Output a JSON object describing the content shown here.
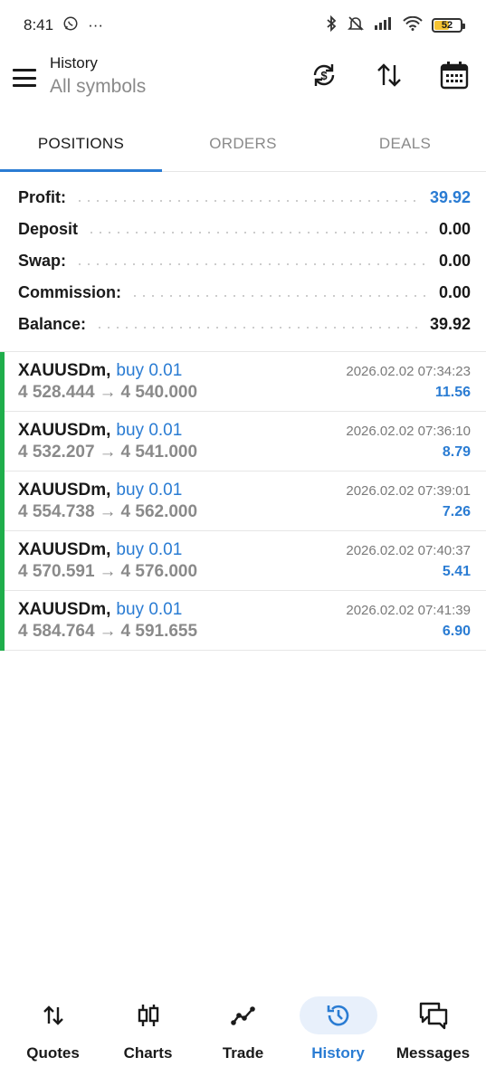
{
  "status_bar": {
    "time": "8:41",
    "more": "···",
    "battery": "52"
  },
  "header": {
    "title": "History",
    "subtitle": "All symbols"
  },
  "tabs": [
    {
      "label": "POSITIONS",
      "active": true
    },
    {
      "label": "ORDERS",
      "active": false
    },
    {
      "label": "DEALS",
      "active": false
    }
  ],
  "summary": [
    {
      "label": "Profit:",
      "value": "39.92",
      "highlight": true
    },
    {
      "label": "Deposit",
      "value": "0.00",
      "highlight": false
    },
    {
      "label": "Swap:",
      "value": "0.00",
      "highlight": false
    },
    {
      "label": "Commission:",
      "value": "0.00",
      "highlight": false
    },
    {
      "label": "Balance:",
      "value": "39.92",
      "highlight": false
    }
  ],
  "positions": [
    {
      "symbol": "XAUUSDm",
      "direction": "buy 0.01",
      "open_price": "4 528.444",
      "close_price": "4 540.000",
      "time": "2026.02.02 07:34:23",
      "profit": "11.56"
    },
    {
      "symbol": "XAUUSDm",
      "direction": "buy 0.01",
      "open_price": "4 532.207",
      "close_price": "4 541.000",
      "time": "2026.02.02 07:36:10",
      "profit": "8.79"
    },
    {
      "symbol": "XAUUSDm",
      "direction": "buy 0.01",
      "open_price": "4 554.738",
      "close_price": "4 562.000",
      "time": "2026.02.02 07:39:01",
      "profit": "7.26"
    },
    {
      "symbol": "XAUUSDm",
      "direction": "buy 0.01",
      "open_price": "4 570.591",
      "close_price": "4 576.000",
      "time": "2026.02.02 07:40:37",
      "profit": "5.41"
    },
    {
      "symbol": "XAUUSDm",
      "direction": "buy 0.01",
      "open_price": "4 584.764",
      "close_price": "4 591.655",
      "time": "2026.02.02 07:41:39",
      "profit": "6.90"
    }
  ],
  "bottom_nav": [
    {
      "label": "Quotes",
      "icon": "quotes-icon",
      "active": false
    },
    {
      "label": "Charts",
      "icon": "charts-icon",
      "active": false
    },
    {
      "label": "Trade",
      "icon": "trade-icon",
      "active": false
    },
    {
      "label": "History",
      "icon": "history-icon",
      "active": true
    },
    {
      "label": "Messages",
      "icon": "messages-icon",
      "active": false
    }
  ],
  "colors": {
    "accent": "#2a7cd3",
    "profit_bar": "#1fae4b",
    "muted": "#8a8a8a"
  }
}
